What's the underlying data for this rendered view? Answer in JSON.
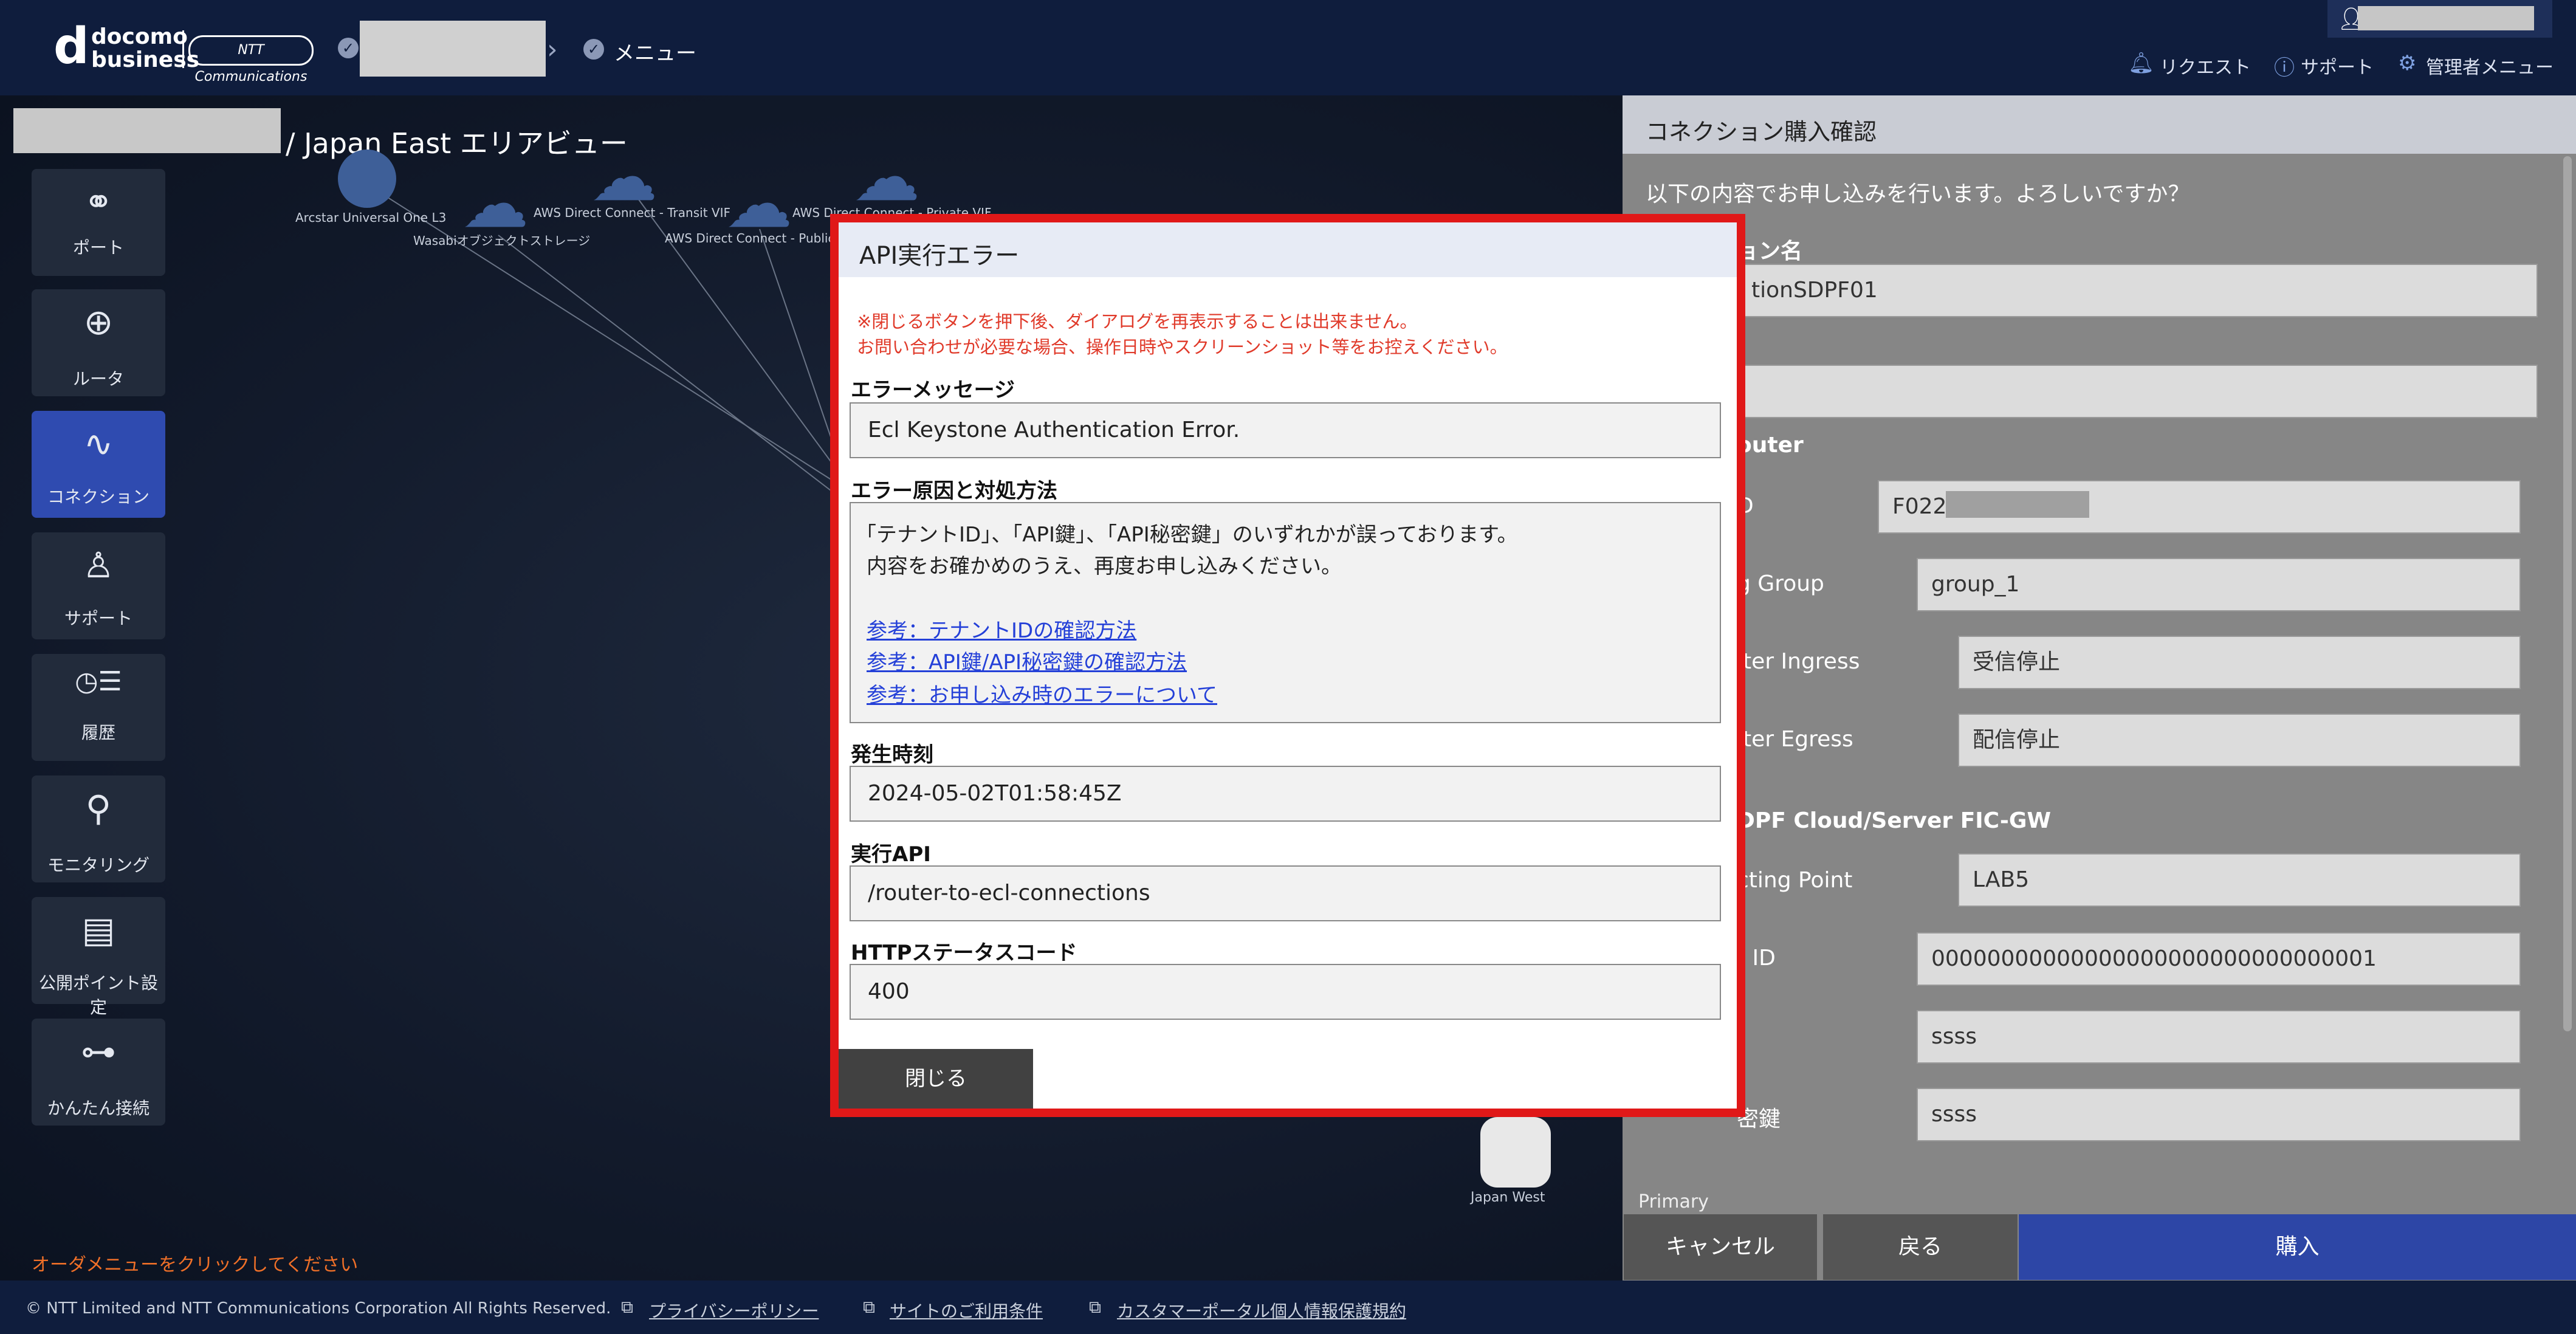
{
  "header": {
    "logo_d": "d",
    "logo_brand": "docomo\nbusiness",
    "logo_ntt": "NTT Communications",
    "breadcrumb_menu": "メニュー",
    "links": [
      {
        "label": "リクエスト",
        "icon": "bell-icon"
      },
      {
        "label": "サポート",
        "icon": "help-icon"
      },
      {
        "label": "管理者メニュー",
        "icon": "gear-icon"
      }
    ]
  },
  "map": {
    "area_title": "/ Japan East エリアビュー",
    "nodes": [
      {
        "label": "Arcstar Universal One L3",
        "icon": "globe-icon"
      },
      {
        "label": "Wasabiオブジェクトストレージ",
        "icon": "cloud-icon"
      },
      {
        "label": "AWS Direct Connect - Transit VIF",
        "icon": "cloud-icon"
      },
      {
        "label": "AWS Direct Connect - Public",
        "icon": "cloud-icon"
      },
      {
        "label": "AWS Direct Connect - Private VIF",
        "icon": "cloud-icon"
      },
      {
        "label": "Japan West",
        "icon": "region-icon"
      }
    ],
    "order_hint": "オーダメニューをクリックしてください"
  },
  "sidebar": {
    "items": [
      {
        "label": "ポート",
        "icon": "port-icon"
      },
      {
        "label": "ルータ",
        "icon": "router-icon"
      },
      {
        "label": "コネクション",
        "icon": "connection-icon"
      },
      {
        "label": "サポート",
        "icon": "support-icon"
      },
      {
        "label": "履歴",
        "icon": "history-icon"
      },
      {
        "label": "モニタリング",
        "icon": "monitoring-icon"
      },
      {
        "label": "公開ポイント設定",
        "icon": "public-point-icon"
      },
      {
        "label": "かんたん接続",
        "icon": "easy-connect-icon"
      }
    ]
  },
  "right_panel": {
    "title": "コネクション購入確認",
    "question": "以下の内容でお申し込みを行います。よろしいですか？",
    "conn_name_label": "ョン名",
    "conn_name_value": "tionSDPF01",
    "router_section": "outer",
    "rows": [
      {
        "label": "D",
        "value": "F022"
      },
      {
        "label": "g Group",
        "value": "group_1"
      },
      {
        "label": "lter Ingress",
        "value": "受信停止"
      },
      {
        "label": "lter Egress",
        "value": "配信停止"
      }
    ],
    "sdpf_section": "DPF Cloud/Server FIC-GW",
    "rows2": [
      {
        "label": "cting Point",
        "value": "LAB5"
      },
      {
        "label": "t ID",
        "value": "00000000000000000000000000000001"
      },
      {
        "label": "",
        "value": "ssss"
      },
      {
        "label": "密鍵",
        "value": "ssss"
      }
    ],
    "primary_label": "Primary",
    "buttons": {
      "cancel": "キャンセル",
      "back": "戻る",
      "buy": "購入"
    }
  },
  "modal": {
    "title": "API実行エラー",
    "warnings": [
      "※閉じるボタンを押下後、ダイアログを再表示することは出来ません。",
      "お問い合わせが必要な場合、操作日時やスクリーンショット等をお控えください。"
    ],
    "error_message_label": "エラーメッセージ",
    "error_message": "Ecl Keystone Authentication Error.",
    "cause_label": "エラー原因と対処方法",
    "cause_lines": [
      "「テナントID」、「API鍵」、「API秘密鍵」のいずれかが誤っております。",
      "内容をお確かめのうえ、再度お申し込みください。"
    ],
    "cause_links": [
      "参考：テナントIDの確認方法",
      "参考：API鍵/API秘密鍵の確認方法",
      "参考：お申し込み時のエラーについて"
    ],
    "time_label": "発生時刻",
    "time_value": "2024-05-02T01:58:45Z",
    "api_label": "実行API",
    "api_value": "/router-to-ecl-connections",
    "status_label": "HTTPステータスコード",
    "status_value": "400",
    "close_button": "閉じる"
  },
  "footer": {
    "copyright": "© NTT Limited and NTT Communications Corporation All Rights Reserved.",
    "links": [
      "プライバシーポリシー",
      "サイトのご利用条件",
      "カスタマーポータル個人情報保護規約"
    ]
  }
}
